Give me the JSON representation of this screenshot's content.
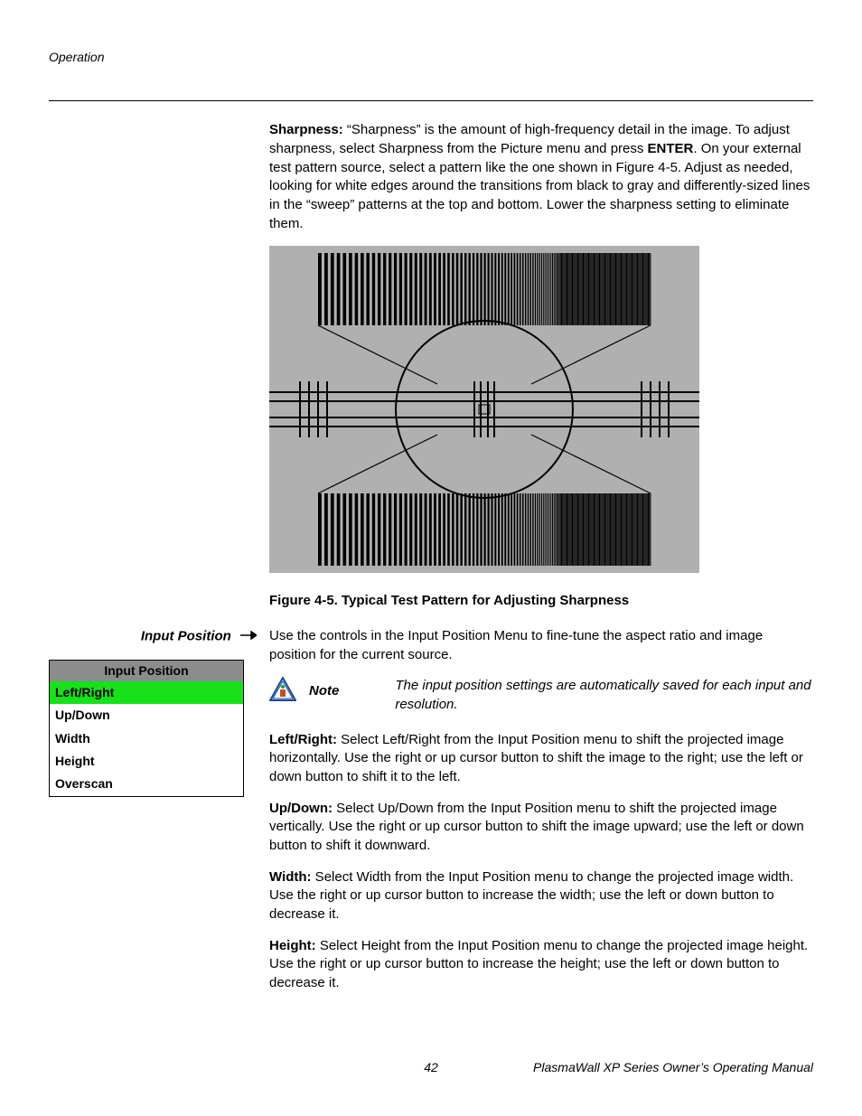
{
  "header": {
    "section": "Operation"
  },
  "sharpness": {
    "label": "Sharpness:",
    "body": " “Sharpness” is the amount of high-frequency detail in the image. To adjust sharpness, select Sharpness from the Picture menu and press ",
    "enter": "ENTER",
    "body2": ". On your external test pattern source, select a pattern like the one shown in Figure 4-5. Adjust as needed, looking for white edges around the transitions from black to gray and differently-sized lines in the “sweep” patterns at the top and bottom. Lower the sharpness setting to eliminate them."
  },
  "figure_caption": "Figure 4-5. Typical Test Pattern for Adjusting Sharpness",
  "margin": {
    "label": "Input Position"
  },
  "input_position_intro": "Use the controls in the Input Position Menu to fine-tune the aspect ratio and image position for the current source.",
  "menu": {
    "title": "Input Position",
    "items": [
      "Left/Right",
      "Up/Down",
      "Width",
      "Height",
      "Overscan"
    ],
    "selected_index": 0
  },
  "note": {
    "label": "Note",
    "text": "The input position settings are automatically saved for each input and resolution."
  },
  "paras": {
    "lr_label": "Left/Right:",
    "lr_body": " Select Left/Right from the Input Position menu to shift the projected image horizontally. Use the right or up cursor button to shift the image to the right; use the left or down button to shift it to the left.",
    "ud_label": "Up/Down:",
    "ud_body": " Select Up/Down from the Input Position menu to shift the projected image vertically. Use the right or up cursor button to shift the image upward; use the left or down button to shift it downward.",
    "w_label": "Width:",
    "w_body": " Select Width from the Input Position menu to change the projected image width. Use the right or up cursor button to increase the width; use the left or down button to decrease it.",
    "h_label": "Height:",
    "h_body": " Select Height from the Input Position menu to change the projected image height. Use the right or up cursor button to increase the height; use the left or down button to decrease it."
  },
  "footer": {
    "page": "42",
    "doc": "PlasmaWall XP Series Owner’s Operating Manual"
  }
}
